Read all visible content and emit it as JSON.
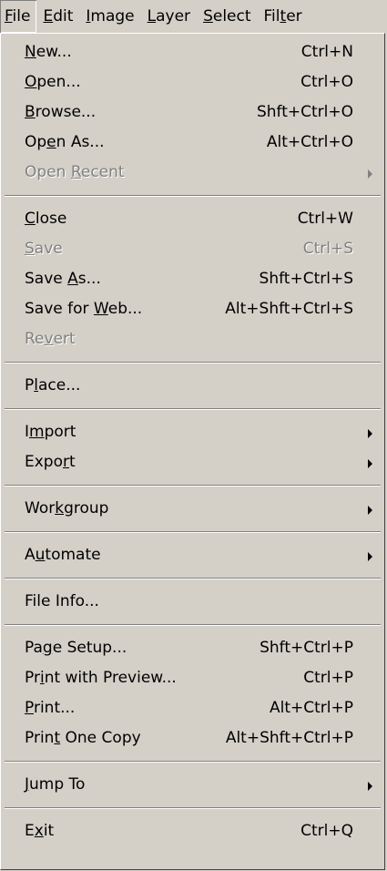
{
  "menubar": [
    {
      "pre": "",
      "u": "F",
      "post": "ile",
      "open": true
    },
    {
      "pre": "",
      "u": "E",
      "post": "dit"
    },
    {
      "pre": "",
      "u": "I",
      "post": "mage"
    },
    {
      "pre": "",
      "u": "L",
      "post": "ayer"
    },
    {
      "pre": "",
      "u": "S",
      "post": "elect"
    },
    {
      "pre": "Fil",
      "u": "t",
      "post": "er"
    }
  ],
  "groups": [
    [
      {
        "pre": "",
        "u": "N",
        "post": "ew...",
        "shortcut": "Ctrl+N"
      },
      {
        "pre": "",
        "u": "O",
        "post": "pen...",
        "shortcut": "Ctrl+O"
      },
      {
        "pre": "",
        "u": "B",
        "post": "rowse...",
        "shortcut": "Shft+Ctrl+O"
      },
      {
        "pre": "Op",
        "u": "e",
        "post": "n As...",
        "shortcut": "Alt+Ctrl+O"
      },
      {
        "pre": "Open ",
        "u": "R",
        "post": "ecent",
        "shortcut": "",
        "disabled": true,
        "submenu": true
      }
    ],
    [
      {
        "pre": "",
        "u": "C",
        "post": "lose",
        "shortcut": "Ctrl+W"
      },
      {
        "pre": "",
        "u": "S",
        "post": "ave",
        "shortcut": "Ctrl+S",
        "disabled": true
      },
      {
        "pre": "Save ",
        "u": "A",
        "post": "s...",
        "shortcut": "Shft+Ctrl+S"
      },
      {
        "pre": "Save for ",
        "u": "W",
        "post": "eb...",
        "shortcut": "Alt+Shft+Ctrl+S"
      },
      {
        "pre": "Re",
        "u": "v",
        "post": "ert",
        "shortcut": "",
        "disabled": true
      }
    ],
    [
      {
        "pre": "P",
        "u": "l",
        "post": "ace...",
        "shortcut": ""
      }
    ],
    [
      {
        "pre": "I",
        "u": "m",
        "post": "port",
        "shortcut": "",
        "submenu": true
      },
      {
        "pre": "Expo",
        "u": "r",
        "post": "t",
        "shortcut": "",
        "submenu": true
      }
    ],
    [
      {
        "pre": "Wor",
        "u": "k",
        "post": "group",
        "shortcut": "",
        "submenu": true
      }
    ],
    [
      {
        "pre": "A",
        "u": "u",
        "post": "tomate",
        "shortcut": "",
        "submenu": true
      }
    ],
    [
      {
        "pre": "File Info...",
        "u": "",
        "post": "",
        "shortcut": ""
      }
    ],
    [
      {
        "pre": "Pa",
        "u": "g",
        "post": "e Setup...",
        "shortcut": "Shft+Ctrl+P"
      },
      {
        "pre": "Pr",
        "u": "i",
        "post": "nt with Preview...",
        "shortcut": "Ctrl+P"
      },
      {
        "pre": "",
        "u": "P",
        "post": "rint...",
        "shortcut": "Alt+Ctrl+P"
      },
      {
        "pre": "Prin",
        "u": "t",
        "post": " One Copy",
        "shortcut": "Alt+Shft+Ctrl+P"
      }
    ],
    [
      {
        "pre": "",
        "u": "J",
        "post": "ump To",
        "shortcut": "",
        "submenu": true
      }
    ],
    [
      {
        "pre": "E",
        "u": "x",
        "post": "it",
        "shortcut": "Ctrl+Q"
      }
    ]
  ]
}
